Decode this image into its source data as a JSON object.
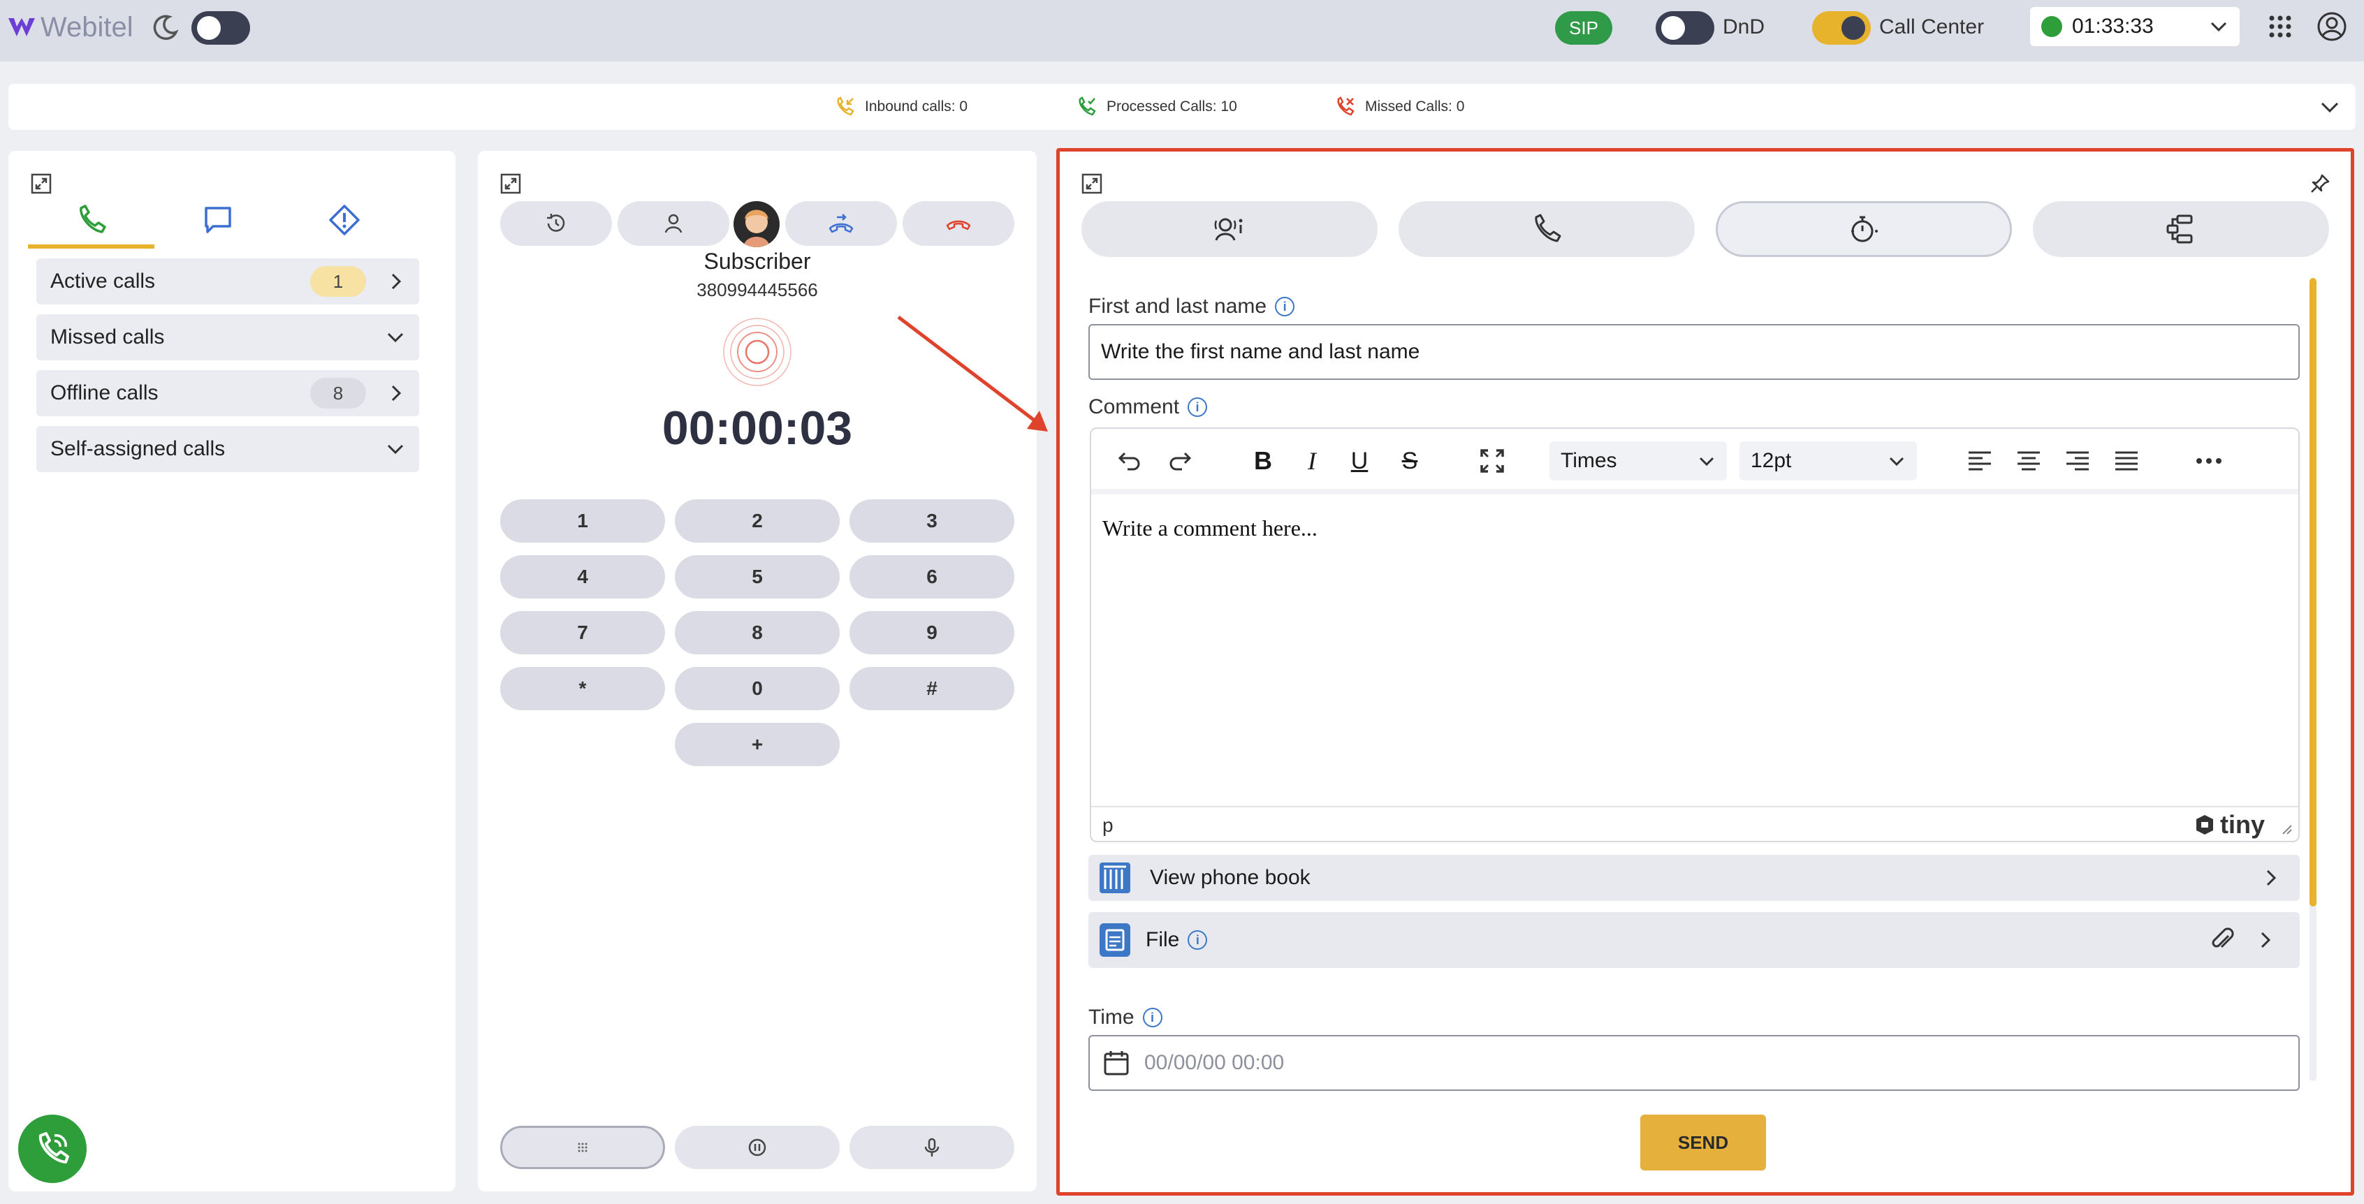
{
  "app": {
    "name": "Webitel"
  },
  "topbar": {
    "sip_label": "SIP",
    "dnd_label": "DnD",
    "callcenter_label": "Call Center",
    "status_timer": "01:33:33",
    "colors": {
      "sip": "#2f9a48",
      "accent": "#e7b32c",
      "online": "#2e9e3a"
    }
  },
  "stats": {
    "inbound": "Inbound calls: 0",
    "processed": "Processed Calls: 10",
    "missed": "Missed Calls: 0"
  },
  "queue_panel": {
    "tabs": [
      "phone-icon",
      "chat-icon",
      "alert-icon"
    ],
    "items": [
      {
        "label": "Active calls",
        "badge": "1",
        "chevron": "right"
      },
      {
        "label": "Missed calls",
        "badge": "",
        "chevron": "down"
      },
      {
        "label": "Offline calls",
        "badge": "8",
        "chevron": "right"
      },
      {
        "label": "Self-assigned calls",
        "badge": "",
        "chevron": "down"
      }
    ]
  },
  "call_panel": {
    "subscriber_name": "Subscriber",
    "subscriber_number": "380994445566",
    "timer": "00:00:03",
    "keys": [
      "1",
      "2",
      "3",
      "4",
      "5",
      "6",
      "7",
      "8",
      "9",
      "*",
      "0",
      "#",
      "+"
    ]
  },
  "form_panel": {
    "name_label": "First and last name",
    "name_value": "Write the first name and last name",
    "comment_label": "Comment",
    "font_family": "Times",
    "font_size": "12pt",
    "editor_placeholder": "Write a comment here...",
    "status_path": "p",
    "editor_brand": "tiny",
    "phone_book_label": "View phone book",
    "file_label": "File",
    "time_label": "Time",
    "time_placeholder": "00/00/00 00:00",
    "send_label": "SEND"
  }
}
